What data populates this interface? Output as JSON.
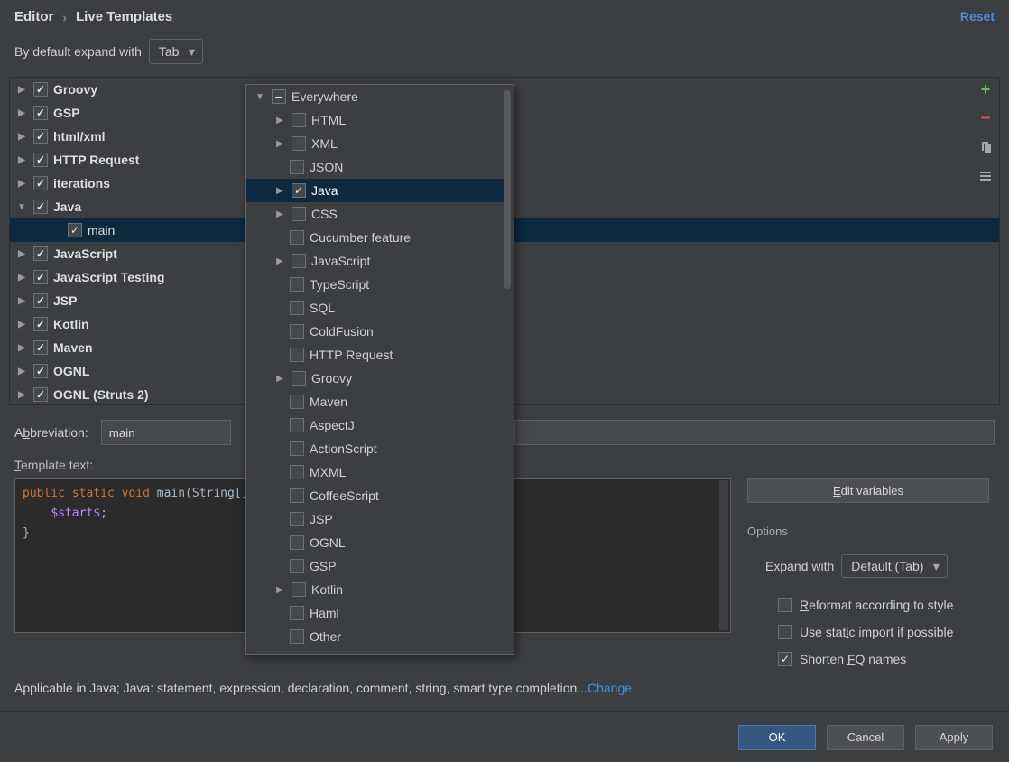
{
  "breadcrumb": {
    "parent": "Editor",
    "current": "Live Templates"
  },
  "reset_label": "Reset",
  "expand": {
    "label": "By default expand with",
    "value": "Tab"
  },
  "tree": {
    "items": [
      {
        "label": "Groovy",
        "checked": "on",
        "arrow": "right",
        "bold": true
      },
      {
        "label": "GSP",
        "checked": "on",
        "arrow": "right",
        "bold": true
      },
      {
        "label": "html/xml",
        "checked": "on",
        "arrow": "right",
        "bold": true
      },
      {
        "label": "HTTP Request",
        "checked": "on",
        "arrow": "right",
        "bold": true
      },
      {
        "label": "iterations",
        "checked": "on",
        "arrow": "right",
        "bold": true
      },
      {
        "label": "Java",
        "checked": "on",
        "arrow": "down",
        "bold": true
      },
      {
        "label": "main",
        "checked": "on",
        "arrow": "none",
        "bold": false,
        "indent": 1,
        "selected": true
      },
      {
        "label": "JavaScript",
        "checked": "on",
        "arrow": "right",
        "bold": true
      },
      {
        "label": "JavaScript Testing",
        "checked": "on",
        "arrow": "right",
        "bold": true
      },
      {
        "label": "JSP",
        "checked": "on",
        "arrow": "right",
        "bold": true
      },
      {
        "label": "Kotlin",
        "checked": "on",
        "arrow": "right",
        "bold": true
      },
      {
        "label": "Maven",
        "checked": "on",
        "arrow": "right",
        "bold": true
      },
      {
        "label": "OGNL",
        "checked": "on",
        "arrow": "right",
        "bold": true
      },
      {
        "label": "OGNL (Struts 2)",
        "checked": "on",
        "arrow": "right",
        "bold": true
      }
    ]
  },
  "popup": {
    "items": [
      {
        "label": "Everywhere",
        "level": 0,
        "arrow": "down",
        "checked": "mixed"
      },
      {
        "label": "HTML",
        "level": 1,
        "arrow": "right",
        "checked": "off"
      },
      {
        "label": "XML",
        "level": 1,
        "arrow": "right",
        "checked": "off"
      },
      {
        "label": "JSON",
        "level": 1,
        "arrow": "none",
        "checked": "off"
      },
      {
        "label": "Java",
        "level": 1,
        "arrow": "right",
        "checked": "on",
        "selected": true
      },
      {
        "label": "CSS",
        "level": 1,
        "arrow": "right",
        "checked": "off"
      },
      {
        "label": "Cucumber feature",
        "level": 1,
        "arrow": "none",
        "checked": "off"
      },
      {
        "label": "JavaScript",
        "level": 1,
        "arrow": "right",
        "checked": "off"
      },
      {
        "label": "TypeScript",
        "level": 1,
        "arrow": "none",
        "checked": "off"
      },
      {
        "label": "SQL",
        "level": 1,
        "arrow": "none",
        "checked": "off"
      },
      {
        "label": "ColdFusion",
        "level": 1,
        "arrow": "none",
        "checked": "off"
      },
      {
        "label": "HTTP Request",
        "level": 1,
        "arrow": "none",
        "checked": "off"
      },
      {
        "label": "Groovy",
        "level": 1,
        "arrow": "right",
        "checked": "off"
      },
      {
        "label": "Maven",
        "level": 1,
        "arrow": "none",
        "checked": "off"
      },
      {
        "label": "AspectJ",
        "level": 1,
        "arrow": "none",
        "checked": "off"
      },
      {
        "label": "ActionScript",
        "level": 1,
        "arrow": "none",
        "checked": "off"
      },
      {
        "label": "MXML",
        "level": 1,
        "arrow": "none",
        "checked": "off"
      },
      {
        "label": "CoffeeScript",
        "level": 1,
        "arrow": "none",
        "checked": "off"
      },
      {
        "label": "JSP",
        "level": 1,
        "arrow": "none",
        "checked": "off"
      },
      {
        "label": "OGNL",
        "level": 1,
        "arrow": "none",
        "checked": "off"
      },
      {
        "label": "GSP",
        "level": 1,
        "arrow": "none",
        "checked": "off"
      },
      {
        "label": "Kotlin",
        "level": 1,
        "arrow": "right",
        "checked": "off"
      },
      {
        "label": "Haml",
        "level": 1,
        "arrow": "none",
        "checked": "off"
      },
      {
        "label": "Other",
        "level": 1,
        "arrow": "none",
        "checked": "off"
      }
    ]
  },
  "form": {
    "abbr_label": "Abbreviation:",
    "abbr_value": "main",
    "template_label": "Template text:",
    "code_plain": "public static void main(String[] args) {\n    $start$;\n}",
    "edit_vars": "Edit variables",
    "options_label": "Options",
    "expand_with_label": "Expand with",
    "expand_with_value": "Default (Tab)",
    "reformat": {
      "label": "Reformat according to style",
      "checked": "off"
    },
    "static_import": {
      "label": "Use static import if possible",
      "checked": "off"
    },
    "shorten_fq": {
      "label": "Shorten FQ names",
      "checked": "on"
    }
  },
  "applicable": {
    "text": "Applicable in Java; Java: statement, expression, declaration, comment, string, smart type completion...",
    "link": "Change"
  },
  "footer": {
    "ok": "OK",
    "cancel": "Cancel",
    "apply": "Apply"
  }
}
